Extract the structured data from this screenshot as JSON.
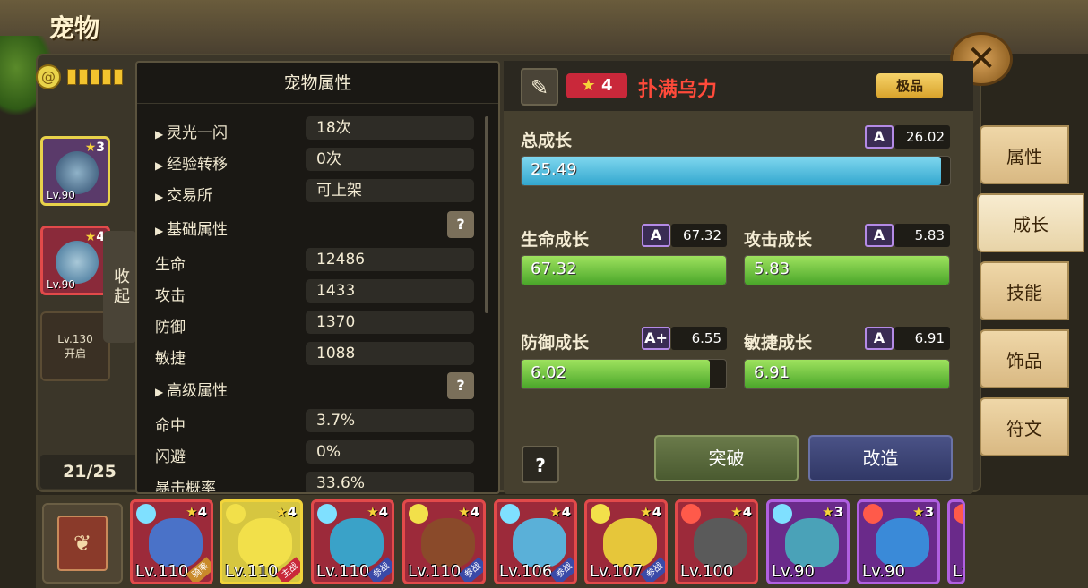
{
  "header": {
    "title": "宠物"
  },
  "energy": {
    "pips": 5
  },
  "sidebar": {
    "slots": [
      {
        "stars": "3",
        "level": "Lv.90",
        "selected": true
      },
      {
        "stars": "4",
        "level": "Lv.90",
        "selected": false
      }
    ],
    "locked": {
      "level": "Lv.130",
      "label": "开启"
    },
    "collapse_label": "收起",
    "count": "21/25"
  },
  "attr_panel": {
    "title": "宠物属性",
    "rows": [
      {
        "label": "灵光一闪",
        "value": "18次"
      },
      {
        "label": "经验转移",
        "value": "0次"
      },
      {
        "label": "交易所",
        "value": "可上架"
      }
    ],
    "basic": {
      "label": "基础属性",
      "help": "?",
      "rows": [
        {
          "label": "生命",
          "value": "12486"
        },
        {
          "label": "攻击",
          "value": "1433"
        },
        {
          "label": "防御",
          "value": "1370"
        },
        {
          "label": "敏捷",
          "value": "1088"
        }
      ]
    },
    "advanced": {
      "label": "高级属性",
      "help": "?",
      "rows": [
        {
          "label": "命中",
          "value": "3.7%"
        },
        {
          "label": "闪避",
          "value": "0%"
        },
        {
          "label": "暴击概率",
          "value": "33.6%"
        }
      ]
    }
  },
  "growth_panel": {
    "star_level": "4",
    "pet_name": "扑满乌力",
    "quality": "极品",
    "total": {
      "label": "总成长",
      "grade": "A",
      "max": "26.02",
      "value": "25.49",
      "fraction": 0.98
    },
    "hp": {
      "label": "生命成长",
      "grade": "A",
      "max": "67.32",
      "value": "67.32",
      "fraction": 1.0
    },
    "atk": {
      "label": "攻击成长",
      "grade": "A",
      "max": "5.83",
      "value": "5.83",
      "fraction": 1.0
    },
    "def": {
      "label": "防御成长",
      "grade": "A+",
      "max": "6.55",
      "value": "6.02",
      "fraction": 0.92
    },
    "agi": {
      "label": "敏捷成长",
      "grade": "A",
      "max": "6.91",
      "value": "6.91",
      "fraction": 1.0
    },
    "help": "?",
    "break_label": "突破",
    "reform_label": "改造"
  },
  "side_tabs": [
    {
      "label": "属性",
      "active": false
    },
    {
      "label": "成长",
      "active": true
    },
    {
      "label": "技能",
      "active": false
    },
    {
      "label": "饰品",
      "active": false
    },
    {
      "label": "符文",
      "active": false
    }
  ],
  "pet_cards": [
    {
      "stars": "4",
      "level": "Lv.110",
      "tag": "骑乘",
      "border": "#e24a4a",
      "bg": "#9c2a3a",
      "body": "#4a72c8",
      "el": "#7fe0ff"
    },
    {
      "stars": "4",
      "level": "Lv.110",
      "tag": "主战",
      "border": "#f2d43a",
      "bg": "#d6c640",
      "body": "#f2e04a",
      "el": "#f2e04a"
    },
    {
      "stars": "4",
      "level": "Lv.110",
      "tag": "参战",
      "border": "#e24a4a",
      "bg": "#9c2a3a",
      "body": "#3aa2c8",
      "el": "#7fe0ff"
    },
    {
      "stars": "4",
      "level": "Lv.110",
      "tag": "参战",
      "border": "#e24a4a",
      "bg": "#9c2a3a",
      "body": "#8a4a2a",
      "el": "#f2e04a"
    },
    {
      "stars": "4",
      "level": "Lv.106",
      "tag": "参战",
      "border": "#e24a4a",
      "bg": "#9c2a3a",
      "body": "#5ab0d8",
      "el": "#7fe0ff"
    },
    {
      "stars": "4",
      "level": "Lv.107",
      "tag": "参战",
      "border": "#e24a4a",
      "bg": "#9c2a3a",
      "body": "#e6c63a",
      "el": "#f2e04a"
    },
    {
      "stars": "4",
      "level": "Lv.100",
      "tag": "",
      "border": "#e24a4a",
      "bg": "#9c2a3a",
      "body": "#5a5a5a",
      "el": "#ff5a4a"
    },
    {
      "stars": "3",
      "level": "Lv.90",
      "tag": "",
      "border": "#b060e0",
      "bg": "#6a2a8a",
      "body": "#4aa2b8",
      "el": "#7fe0ff"
    },
    {
      "stars": "3",
      "level": "Lv.90",
      "tag": "",
      "border": "#b060e0",
      "bg": "#6a2a8a",
      "body": "#3a8ad8",
      "el": "#ff5a4a"
    },
    {
      "stars": "",
      "level": "Lv.",
      "tag": "",
      "border": "#b060e0",
      "bg": "#6a2a8a",
      "body": "#4aa2b8",
      "el": "#ff5a4a"
    }
  ]
}
